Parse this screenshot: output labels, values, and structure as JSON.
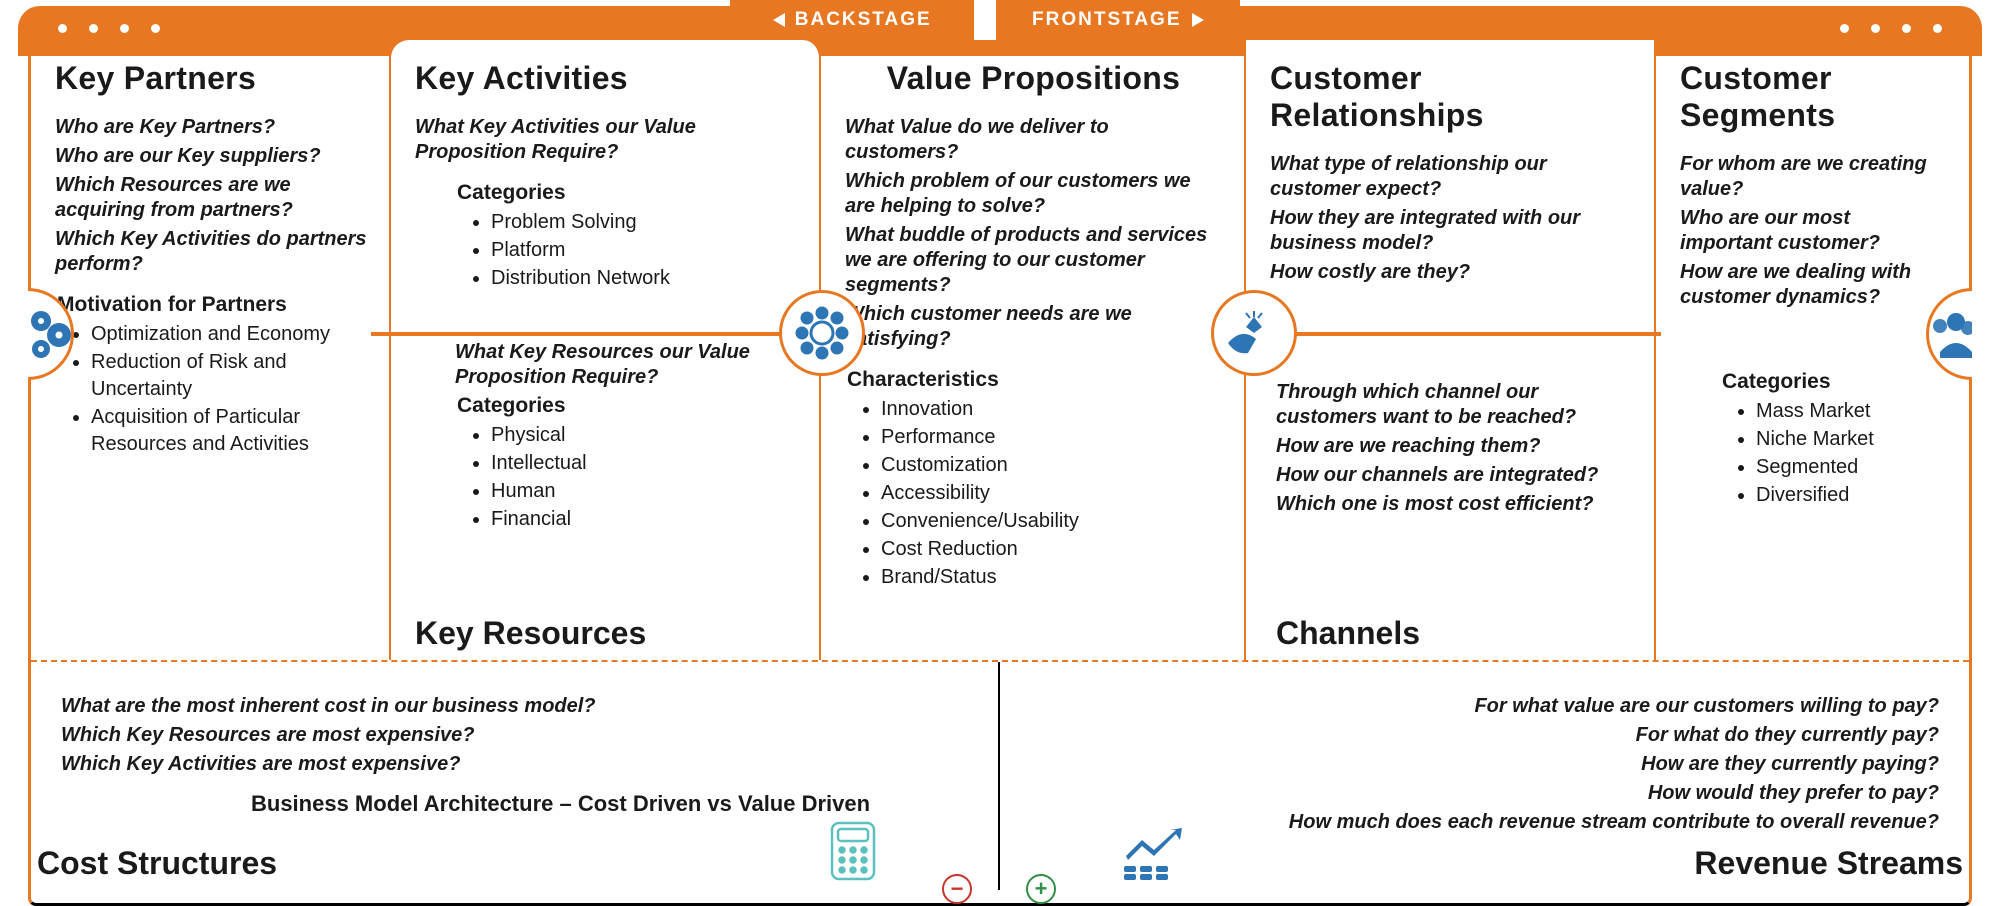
{
  "stage": {
    "back": "BACKSTAGE",
    "front": "FRONTSTAGE"
  },
  "partners": {
    "title": "Key Partners",
    "q": [
      "Who are Key Partners?",
      "Who are our Key suppliers?",
      "Which Resources are we acquiring from partners?",
      "Which Key Activities do partners perform?"
    ],
    "motiv_title": "Motivation for Partners",
    "motiv": [
      "Optimization and Economy",
      "Reduction of Risk and Uncertainty",
      "Acquisition of Particular Resources and Activities"
    ]
  },
  "activities": {
    "title": "Key Activities",
    "q1": "What Key Activities our Value Proposition Require?",
    "cat_title": "Categories",
    "cat": [
      "Problem Solving",
      "Platform",
      "Distribution Network"
    ],
    "q2": "What Key Resources our Value Proposition Require?",
    "rcat_title": "Categories",
    "rcat": [
      "Physical",
      "Intellectual",
      "Human",
      "Financial"
    ],
    "kr_title": "Key Resources"
  },
  "value": {
    "title": "Value Propositions",
    "q": [
      "What Value do we deliver to customers?",
      "Which problem of our customers we are helping to solve?",
      "What buddle of products and services we are offering to our customer segments?",
      "Which customer needs are we satisfying?"
    ],
    "char_title": "Characteristics",
    "char": [
      "Innovation",
      "Performance",
      "Customization",
      "Accessibility",
      "Convenience/Usability",
      "Cost Reduction",
      "Brand/Status"
    ]
  },
  "relationships": {
    "title": "Customer Relationships",
    "q": [
      "What type of relationship our customer expect?",
      "How they are integrated with our business model?",
      "How costly are they?"
    ],
    "channels_title": "Channels",
    "channels_q": [
      "Through which channel our customers want to be reached?",
      "How are we reaching them?",
      "How our channels are integrated?",
      "Which one is most cost efficient?"
    ]
  },
  "segments": {
    "title": "Customer Segments",
    "q": [
      "For whom are we creating value?",
      "Who are our most important customer?",
      "How are we dealing with customer dynamics?"
    ],
    "cat_title": "Categories",
    "cat": [
      "Mass Market",
      "Niche Market",
      "Segmented",
      "Diversified"
    ]
  },
  "cost": {
    "title": "Cost Structures",
    "q": [
      "What are the most inherent cost in our business model?",
      "Which Key Resources are most expensive?",
      "Which Key Activities are most expensive?"
    ],
    "arch": "Business Model Architecture – Cost Driven vs Value Driven"
  },
  "revenue": {
    "title": "Revenue Streams",
    "q": [
      "For what value are our customers willing to pay?",
      "For what do they currently pay?",
      "How are they currently paying?",
      "How would they prefer to pay?",
      "How much does each revenue stream contribute to overall revenue?"
    ]
  }
}
